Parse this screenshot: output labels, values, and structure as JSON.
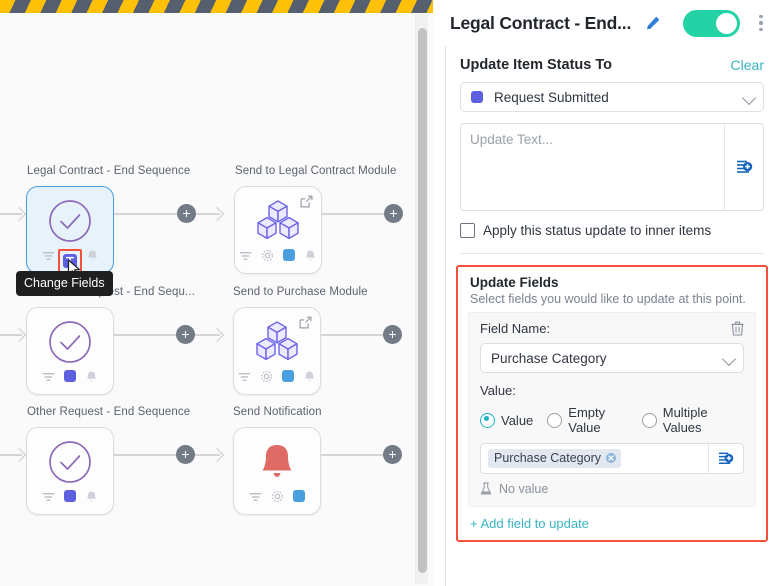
{
  "canvas": {
    "hazard_bar": "diagonal-warning-stripes",
    "nodes": [
      {
        "label": "Legal Contract - End Sequence",
        "icon": "check-circle-icon",
        "selected": true
      },
      {
        "label": "Send to Legal Contract Module",
        "icon": "cubes-module-icon",
        "selected": false
      },
      {
        "label": "Purchase Request - End Sequ...",
        "icon": "check-circle-icon",
        "selected": false
      },
      {
        "label": "Send to Purchase Module",
        "icon": "cubes-module-icon",
        "selected": false
      },
      {
        "label": "Other Request - End Sequence",
        "icon": "check-circle-icon",
        "selected": false
      },
      {
        "label": "Send Notification",
        "icon": "bell-icon",
        "selected": false
      }
    ],
    "add_step_label": "+",
    "tooltip": "Change Fields",
    "colors": {
      "hazard_yellow": "#ffc107",
      "hazard_dark": "#555f6d",
      "selected_node_bg": "#e7f2fb",
      "selected_node_border": "#4a9fe0",
      "highlight_outline": "#f4503b",
      "check_icon": "#8e6ab8",
      "cube_icon": "#6c63e8",
      "bell_icon": "#e06a66",
      "mini_blue": "#4a9fe0",
      "mini_indigo": "#5b5fe0",
      "connector": "#d3d5d9",
      "plus_button": "#737b87"
    }
  },
  "panel": {
    "title": "Legal Contract - End...",
    "edit_icon": "pencil-icon",
    "toggle_on": true,
    "menu_icon": "kebab-menu-icon",
    "status_section": {
      "heading": "Update Item Status To",
      "clear_label": "Clear",
      "selected_status": "Request Submitted",
      "status_color": "#5b5fe0",
      "chevron_icon": "chevron-down-icon"
    },
    "update_text": {
      "value": "",
      "placeholder": "Update Text...",
      "insert_icon": "insert-field-icon"
    },
    "inner_items_checkbox": {
      "label": "Apply this status update to inner items",
      "checked": false
    },
    "update_fields": {
      "heading": "Update Fields",
      "subheading": "Select fields you would like to update at this point.",
      "delete_icon": "trash-icon",
      "field_name_label": "Field Name:",
      "field_name_value": "Purchase Category",
      "value_label": "Value:",
      "radios": [
        {
          "label": "Value",
          "selected": true
        },
        {
          "label": "Empty Value",
          "selected": false
        },
        {
          "label": "Multiple Values",
          "selected": false
        }
      ],
      "value_chip": "Purchase Category",
      "chip_remove_icon": "chip-close-icon",
      "value_insert_icon": "insert-field-icon",
      "no_value_text": "No value",
      "no_value_icon": "flask-icon",
      "add_field_label": "+ Add field to update"
    },
    "colors": {
      "toggle_on": "#23d3a5",
      "link_teal": "#3ab4c4",
      "radio_active": "#1bb3c4",
      "outline_red": "#f4503b",
      "insert_icon_blue": "#1565c0"
    }
  }
}
